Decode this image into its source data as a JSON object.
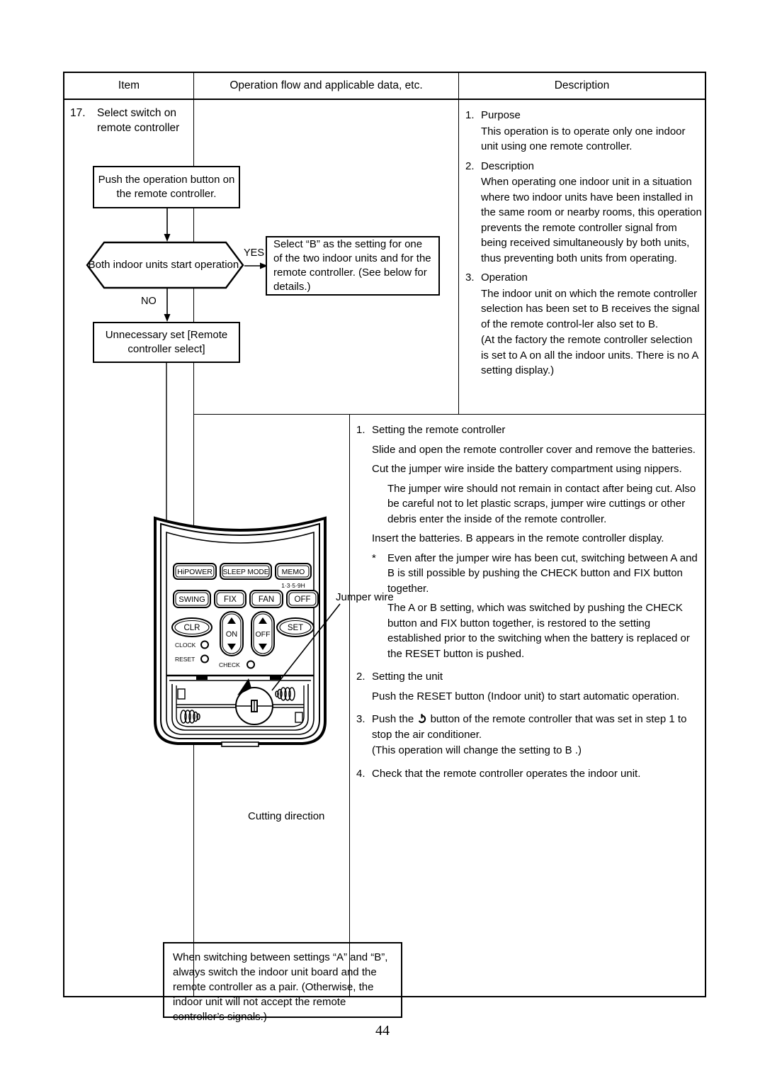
{
  "page": {
    "number": "44"
  },
  "table": {
    "headers": {
      "item": "Item",
      "flow": "Operation flow and applicable data, etc.",
      "description": "Description"
    }
  },
  "item": {
    "number": "17.",
    "title": "Select switch on remote controller"
  },
  "flowchart": {
    "box_push": "Push the operation button on the remote controller.",
    "decision": "Both indoor units start operation.",
    "label_yes": "YES",
    "label_no": "NO",
    "box_select_b": "Select “B” as the setting for one of the two indoor units and for the remote controller. (See below for details.)",
    "box_unnecessary": "Unnecessary set [Remote controller select]"
  },
  "description_upper": {
    "s1": {
      "num": "1.",
      "heading": "Purpose",
      "body": "This operation is to operate only one indoor unit using one remote controller."
    },
    "s2": {
      "num": "2.",
      "heading": "Description",
      "body": "When operating one indoor unit in a situation where two indoor units have been installed in the same room or nearby rooms, this operation prevents the remote controller signal from being received simultaneously by both units, thus preventing both units from operating."
    },
    "s3": {
      "num": "3.",
      "heading": "Operation",
      "body1": "The indoor unit on which the remote controller selection has been set to B receives the signal of the remote control-ler also set to B.",
      "body2": "(At the factory the remote controller selection is set to A on all the indoor units. There is no A setting display.)"
    }
  },
  "description_lower": {
    "s1": {
      "num": "1.",
      "heading": "Setting the remote controller",
      "p1": "Slide and open the remote controller cover and remove the batteries.",
      "p2": "Cut the jumper wire inside the battery compartment using nippers.",
      "p3": "The jumper wire should not remain in contact after being cut. Also be careful not to let plastic scraps, jumper wire cuttings or other debris enter the inside of the remote controller.",
      "p4": "Insert the batteries.  B  appears in the remote controller display.",
      "star": "*",
      "p5": "Even after the jumper wire has been cut, switching between A and B is still possible by pushing the CHECK button and FIX button together.",
      "p6": "The A or B setting, which was switched by pushing the CHECK button and FIX button together, is restored to the setting established prior to the switching when the battery is replaced or the RESET button is pushed."
    },
    "s2": {
      "num": "2.",
      "heading": "Setting the unit",
      "p1": "Push the RESET button (Indoor unit) to start automatic operation."
    },
    "s3": {
      "num": "3.",
      "text_before": "Push the",
      "text_after": "button of the remote controller that was set in step 1 to stop the air conditioner.",
      "p2": "(This operation will change the setting to  B .)"
    },
    "s4": {
      "num": "4.",
      "text": "Check that the remote controller operates the indoor unit."
    }
  },
  "illustration": {
    "label_jumper_wire": "Jumper wire",
    "label_cutting_direction": "Cutting direction",
    "buttons": {
      "hipower": "HiPOWER",
      "sleep_mode": "SLEEP MODE",
      "memo": "MEMO",
      "swing": "SWING",
      "fix": "FIX",
      "fan": "FAN",
      "off_timer": "OFF",
      "off_timer_note": "1·3·5·9H",
      "clr": "CLR",
      "on": "ON",
      "off": "OFF",
      "set": "SET",
      "clock": "CLOCK",
      "reset": "RESET",
      "check": "CHECK"
    }
  },
  "warning": {
    "text": "When switching between settings “A” and “B”, always switch the indoor unit board and the remote controller as a pair. (Otherwise, the indoor unit will not accept the remote controller’s signals.)"
  },
  "colors": {
    "line": "#000000",
    "background": "#ffffff"
  }
}
